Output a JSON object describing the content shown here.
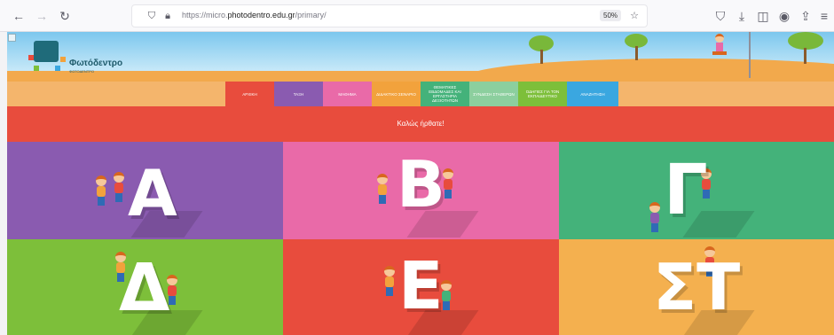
{
  "browser": {
    "url_prefix": "https://micro.",
    "url_domain": "photodentro.edu.gr",
    "url_path": "/primary/",
    "zoom": "50%",
    "icons": [
      "back-icon",
      "forward-icon",
      "reload-icon",
      "shield-icon",
      "lock-icon",
      "star-icon",
      "pocket-icon",
      "download-icon",
      "sidebar-icon",
      "account-icon",
      "share-icon",
      "menu-icon"
    ]
  },
  "site": {
    "logo_text": "Φωτόδεντρο",
    "logo_sub": "ΦΩΤΟΔΕΝΤΡΟ"
  },
  "nav": {
    "items": [
      {
        "label": "ΑΡΧΙΚΗ",
        "color": "#e84c3d"
      },
      {
        "label": "ΤΑΞΗ",
        "color": "#8a5bb0"
      },
      {
        "label": "ΜΑΘΗΜΑ",
        "color": "#e96aa8"
      },
      {
        "label": "ΔΙΔΑΚΤΙΚΟ ΣΕΝΑΡΙΟ",
        "color": "#f2a23c"
      },
      {
        "label": "ΘΕΜΑΤΙΚΕΣ ΕΒΔΟΜΑΔΕΣ ΚΑΙ ΕΡΓΑΣΤΗΡΙΑ ΔΕΞΙΟΤΗΤΩΝ",
        "color": "#44b27a"
      },
      {
        "label": "ΣΥΝΔΕΣΗ ΣΤΑΘΕΡΩΝ",
        "color": "#8ccf9e"
      },
      {
        "label": "ΟΔΗΓΙΕΣ ΓΙΑ ΤΟΝ ΕΚΠΑΙΔΕΥΤΙΚΟ",
        "color": "#7dbf3a"
      },
      {
        "label": "ΑΝΑΖΗΤΗΣΗ",
        "color": "#3aa7e0"
      }
    ]
  },
  "welcome": "Καλώς ήρθατε!",
  "grades": [
    {
      "letter": "Α",
      "color": "#8a5bb0"
    },
    {
      "letter": "Β",
      "color": "#e96aa8"
    },
    {
      "letter": "Γ",
      "color": "#44b27a"
    },
    {
      "letter": "Δ",
      "color": "#7dbf3a"
    },
    {
      "letter": "Ε",
      "color": "#e84c3d"
    },
    {
      "letter": "ΣΤ",
      "color": "#f4b04f"
    }
  ]
}
